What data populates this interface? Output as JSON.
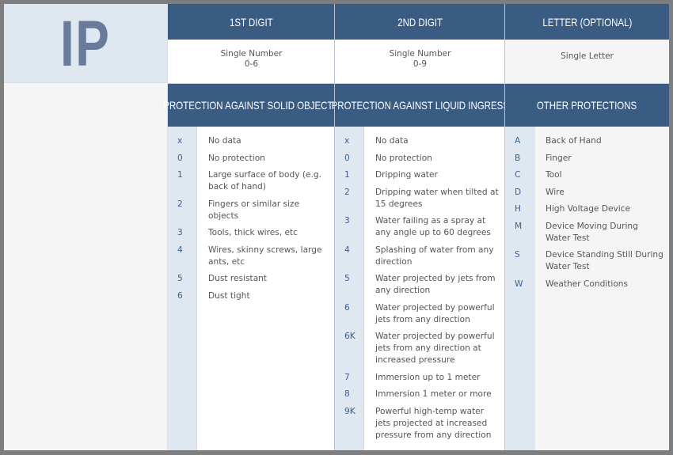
{
  "logo": {
    "text": "IP"
  },
  "columns": [
    {
      "header": "1st Digit",
      "sub_line1": "Single Number",
      "sub_line2": "0-6",
      "section_title": "Protection Against Solid Objects",
      "rows": [
        {
          "code": "x",
          "desc": "No data"
        },
        {
          "code": "0",
          "desc": "No protection"
        },
        {
          "code": "1",
          "desc": "Large surface of body (e.g. back of hand)"
        },
        {
          "code": "2",
          "desc": "Fingers or similar size objects"
        },
        {
          "code": "3",
          "desc": "Tools, thick wires, etc"
        },
        {
          "code": "4",
          "desc": "Wires, skinny screws, large ants, etc"
        },
        {
          "code": "5",
          "desc": "Dust resistant"
        },
        {
          "code": "6",
          "desc": "Dust tight"
        }
      ]
    },
    {
      "header": "2nd Digit",
      "sub_line1": "Single Number",
      "sub_line2": "0-9",
      "section_title": "Protection Against Liquid Ingress",
      "rows": [
        {
          "code": "x",
          "desc": "No data"
        },
        {
          "code": "0",
          "desc": "No protection"
        },
        {
          "code": "1",
          "desc": "Dripping water"
        },
        {
          "code": "2",
          "desc": "Dripping water when tilted at 15 degrees"
        },
        {
          "code": "3",
          "desc": "Water failing as a spray at any angle up to 60 degrees"
        },
        {
          "code": "4",
          "desc": "Splashing of water from any direction"
        },
        {
          "code": "5",
          "desc": "Water projected by jets from any direction"
        },
        {
          "code": "6",
          "desc": "Water projected by powerful jets from any direction"
        },
        {
          "code": "6K",
          "desc": "Water projected by powerful jets from any direction at increased pressure"
        },
        {
          "code": "7",
          "desc": "Immersion up to 1 meter"
        },
        {
          "code": "8",
          "desc": "Immersion 1 meter or more"
        },
        {
          "code": "9K",
          "desc": "Powerful high-temp water jets projected at increased pressure from any direction"
        }
      ]
    },
    {
      "header": "Letter (Optional)",
      "sub_line1": "Single Letter",
      "sub_line2": "",
      "section_title": "Other Protections",
      "rows": [
        {
          "code": "A",
          "desc": "Back of Hand"
        },
        {
          "code": "B",
          "desc": "Finger"
        },
        {
          "code": "C",
          "desc": "Tool"
        },
        {
          "code": "D",
          "desc": "Wire"
        },
        {
          "code": "H",
          "desc": "High Voltage Device"
        },
        {
          "code": "M",
          "desc": "Device Moving During Water Test"
        },
        {
          "code": "S",
          "desc": "Device Standing Still During Water Test"
        },
        {
          "code": "W",
          "desc": "Weather Conditions"
        }
      ]
    }
  ]
}
